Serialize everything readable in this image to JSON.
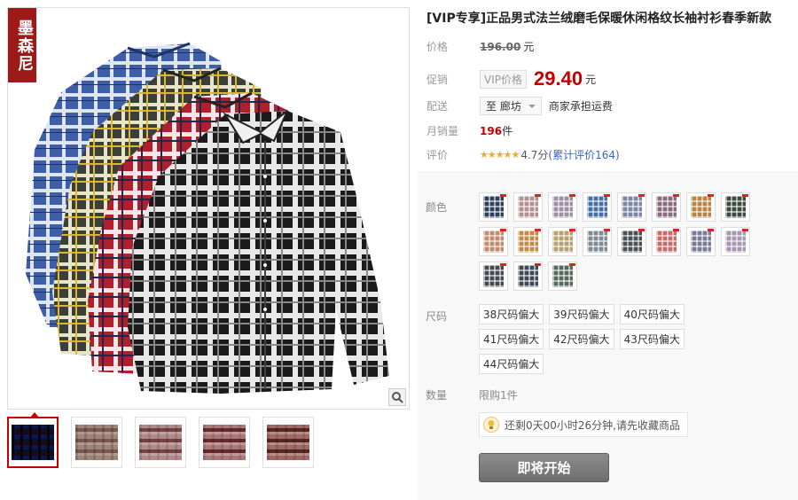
{
  "gallery": {
    "brand_text": "墨森尼",
    "thumbnails": [
      {
        "name": "thumb-1",
        "colors": [
          "#2c4f8f",
          "#3a3a3a",
          "#a9182c"
        ]
      },
      {
        "name": "thumb-2",
        "colors": [
          "#c9b8b0",
          "#9a7a70",
          "#e0d5cf"
        ]
      },
      {
        "name": "thumb-3",
        "colors": [
          "#d4bcbc",
          "#8a5b5b",
          "#e7dede"
        ]
      },
      {
        "name": "thumb-4",
        "colors": [
          "#cfb0b0",
          "#7b3b3b",
          "#ece0e0"
        ]
      },
      {
        "name": "thumb-5",
        "colors": [
          "#c8a5a0",
          "#6a3d3a",
          "#e9dcd8"
        ]
      }
    ]
  },
  "product": {
    "title": "[VIP专享]正品男式法兰绒磨毛保暖休闲格纹长袖衬衫春季新款",
    "price_label": "价格",
    "original_price": "196.00",
    "currency_unit": "元",
    "promo_label": "促销",
    "vip_tag": "VIP价格",
    "promo_price": "29.40",
    "shipping_label": "配送",
    "ship_to": "至 廊坊",
    "shipping_note": "商家承担运费",
    "sales_label": "月销量",
    "monthly_sales": "196",
    "sales_unit": "件",
    "rating_label": "评价",
    "stars": "★★★★★",
    "score": "4.7分",
    "review_link": "(累计评价164)"
  },
  "options": {
    "color_label": "颜色",
    "colors": [
      "#2d3f5c",
      "#b69090",
      "#9e8fa6",
      "#4a6ea8",
      "#7e86a6",
      "#8a6a7e",
      "#b98640",
      "#3d4a3e",
      "#c48a6e",
      "#c28a4a",
      "#b8a070",
      "#7e8a94",
      "#4a4f55",
      "#c86a6a",
      "#7a7a96",
      "#a895b2",
      "#454a52",
      "#3d4a55",
      "#556a5a"
    ],
    "size_label": "尺码",
    "sizes": [
      "38尺码偏大",
      "39尺码偏大",
      "40尺码偏大",
      "41尺码偏大",
      "42尺码偏大",
      "43尺码偏大",
      "44尺码偏大"
    ],
    "qty_label": "数量",
    "qty_limit": "限购1件",
    "timer_text": "还剩0天00小时26分钟,请先收藏商品",
    "start_button": "即将开始"
  },
  "icons": {
    "zoom": "magnifier-icon",
    "bulb": "lightbulb-icon"
  },
  "theme": {
    "accent": "#c40000",
    "brand_bg": "#9c1b18",
    "link": "#3366cc"
  }
}
